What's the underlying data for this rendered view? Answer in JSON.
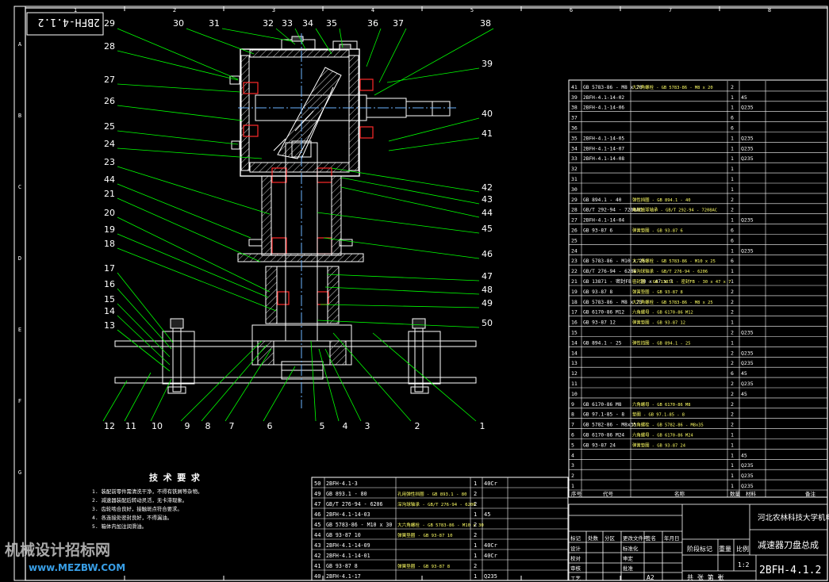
{
  "drawing": {
    "code": "2BFH-4.1.2",
    "code_rotated": "2BFH-4.1.2",
    "title": "减速器刀盘总成",
    "institution": "河北农林科技大学机电学院",
    "scale": "1:2",
    "sheet_size": "A2",
    "grid_cols": [
      "1",
      "2",
      "3",
      "4",
      "5",
      "6",
      "7",
      "8"
    ],
    "grid_rows": [
      "A",
      "B",
      "C",
      "D",
      "E",
      "F",
      "G"
    ]
  },
  "balloons_top": [
    "29",
    "30",
    "31",
    "32",
    "33",
    "34",
    "35",
    "36",
    "37",
    "38"
  ],
  "balloons_left": [
    "28",
    "27",
    "26",
    "25",
    "24",
    "23",
    "44",
    "21",
    "20",
    "19",
    "18",
    "17",
    "16",
    "15",
    "14",
    "13"
  ],
  "balloons_right": [
    "39",
    "40",
    "41",
    "42",
    "43",
    "44",
    "45",
    "46",
    "47",
    "48",
    "49",
    "50"
  ],
  "balloons_bottom": [
    "12",
    "11",
    "10",
    "9",
    "8",
    "7",
    "6",
    "5",
    "4",
    "3",
    "2",
    "1"
  ],
  "tech_req": {
    "title": "技 术 要 求",
    "items": [
      "1. 装配前零件需清洗干净，不得有铁屑等杂物。",
      "2. 减速器装配后转动灵活，无卡滞现象。",
      "3. 齿轮啮合良好，接触斑点符合要求。",
      "4. 各连接处密封良好，不得漏油。",
      "5. 箱体内加注润滑油。"
    ]
  },
  "bom_right": [
    [
      "41",
      "GB 5783-86 - M8 x 20",
      "大六角螺栓 - GB 5783-86 - M8 x 20",
      "2",
      "",
      ""
    ],
    [
      "39",
      "2BFH-4.1-14-02",
      "",
      "1",
      "45",
      ""
    ],
    [
      "38",
      "2BFH-4.1-14-06",
      "",
      "1",
      "Q235",
      ""
    ],
    [
      "37",
      "",
      "",
      "6",
      "",
      ""
    ],
    [
      "36",
      "",
      "",
      "6",
      "",
      ""
    ],
    [
      "35",
      "2BFH-4.1-14-05",
      "",
      "1",
      "Q235",
      ""
    ],
    [
      "34",
      "2BFH-4.1-14-07",
      "",
      "1",
      "Q235",
      ""
    ],
    [
      "33",
      "2BFH-4.1-14-08",
      "",
      "1",
      "Q235",
      ""
    ],
    [
      "32",
      "",
      "",
      "1",
      "",
      ""
    ],
    [
      "31",
      "",
      "",
      "1",
      "",
      ""
    ],
    [
      "30",
      "",
      "",
      "1",
      "",
      ""
    ],
    [
      "29",
      "GB 894.1 - 40",
      "弹性挡圈 - GB 894.1 - 40",
      "2",
      "",
      ""
    ],
    [
      "28",
      "GB/T 292-94 - 7208AC",
      "角接触球轴承 - GB/T 292-94 - 7208AC",
      "2",
      "",
      ""
    ],
    [
      "27",
      "2BFH-4.1-14-04",
      "",
      "1",
      "Q235",
      ""
    ],
    [
      "26",
      "GB 93-87 6",
      "弹簧垫圈 - GB 93-87 6",
      "6",
      "",
      ""
    ],
    [
      "25",
      "",
      "",
      "6",
      "",
      ""
    ],
    [
      "24",
      "",
      "",
      "1",
      "Q235",
      ""
    ],
    [
      "23",
      "GB 5783-86 - M10 x 25",
      "大六角螺栓 - GB 5783-86 - M10 x 25",
      "6",
      "",
      ""
    ],
    [
      "22",
      "GB/T 276-94 - 6206",
      "深沟球轴承 - GB/T 276-94 - 6206",
      "1",
      "",
      ""
    ],
    [
      "21",
      "GB 13871 - 密封FB - 30 x 47 x 7",
      "密封圈 - GB 13871 - 密封FB - 30 x 47 x 7",
      "1",
      "",
      ""
    ],
    [
      "19",
      "GB 93-87 8",
      "弹簧垫圈 - GB 93-87 8",
      "2",
      "",
      ""
    ],
    [
      "18",
      "GB 5783-86 - M8 x 25",
      "大六角螺栓 - GB 5783-86 - M8 x 25",
      "2",
      "",
      ""
    ],
    [
      "17",
      "GB 6170-86 M12",
      "六角螺母 - GB 6170-86 M12",
      "2",
      "",
      ""
    ],
    [
      "16",
      "GB 93-87 12",
      "弹簧垫圈 - GB 93-87 12",
      "1",
      "",
      ""
    ],
    [
      "15",
      "",
      "",
      "2",
      "Q235",
      ""
    ],
    [
      "14",
      "GB 894.1 - 25",
      "弹性挡圈 - GB 894.1 - 25",
      "1",
      "",
      ""
    ],
    [
      "14",
      "",
      "",
      "2",
      "Q235",
      ""
    ],
    [
      "13",
      "",
      "",
      "2",
      "Q235",
      ""
    ],
    [
      "12",
      "",
      "",
      "6",
      "45",
      ""
    ],
    [
      "11",
      "",
      "",
      "2",
      "Q235",
      ""
    ],
    [
      "10",
      "",
      "",
      "2",
      "45",
      ""
    ],
    [
      "9",
      "GB 6170-86 M8",
      "六角螺母 - GB 6170-86 M8",
      "2",
      "",
      ""
    ],
    [
      "8",
      "GB 97.1-85 - 8",
      "垫圈 - GB 97.1-85 - 8",
      "2",
      "",
      ""
    ],
    [
      "7",
      "GB 5782-86 - M8x35",
      "六角螺栓 - GB 5782-86 - M8x35",
      "2",
      "",
      ""
    ],
    [
      "6",
      "GB 6170-86 M24",
      "六角螺母 - GB 6170-86 M24",
      "1",
      "",
      ""
    ],
    [
      "5",
      "GB 93-87 24",
      "弹簧垫圈 - GB 93-87 24",
      "1",
      "",
      ""
    ],
    [
      "4",
      "",
      "",
      "1",
      "45",
      ""
    ],
    [
      "3",
      "",
      "",
      "1",
      "Q235",
      ""
    ],
    [
      "2",
      "",
      "",
      "1",
      "Q235",
      ""
    ],
    [
      "1",
      "",
      "",
      "1",
      "Q235",
      ""
    ]
  ],
  "bom_right_header": [
    "序号",
    "代号",
    "名称",
    "数量",
    "材料",
    "备注"
  ],
  "bom_bottom": [
    [
      "50",
      "2BFH-4.1-3",
      "",
      "1",
      "40Cr"
    ],
    [
      "49",
      "GB 893.1 - 80",
      "孔用弹性挡圈 - GB 893.1 - 80",
      "2",
      ""
    ],
    [
      "47",
      "GB/T 276-94 - 6206",
      "深沟球轴承 - GB/T 276-94 - 6206",
      "2",
      ""
    ],
    [
      "46",
      "2BFH-4.1-14-03",
      "",
      "1",
      "45"
    ],
    [
      "45",
      "GB 5783-86 - M10 x 30",
      "大六角螺栓 - GB 5783-86 - M10 x 30",
      "2",
      ""
    ],
    [
      "44",
      "GB 93-87 10",
      "弹簧垫圈 - GB 93-87 10",
      "2",
      ""
    ],
    [
      "43",
      "2BFH-4.1-14-09",
      "",
      "1",
      "40Cr"
    ],
    [
      "42",
      "2BFH-4.1-14-01",
      "",
      "1",
      "40Cr"
    ],
    [
      "41",
      "GB 93-87 8",
      "弹簧垫圈 - GB 93-87 8",
      "2",
      ""
    ],
    [
      "40",
      "2BFH-4.1-17",
      "",
      "1",
      "Q235"
    ]
  ],
  "title_block": {
    "labels_row1": [
      "标记",
      "处数",
      "分区",
      "更改文件号",
      "签名",
      "年月日"
    ],
    "labels_left": [
      "设计",
      "校对",
      "审核",
      "工艺"
    ],
    "labels_mid": [
      "标准化",
      "审定",
      "批准"
    ],
    "stage": "阶段标记",
    "weight": "重量",
    "ratio": "比例",
    "sheets": "共  张  第  张"
  },
  "watermark": {
    "line1": "机械设计招标网",
    "line2": "www.MEZBW.COM"
  },
  "colors": {
    "bg": "#000000",
    "line": "#ffffff",
    "leader": "#00ff00",
    "section": "#ff2a2a",
    "hatch": "#ffffff",
    "center": "#6bb3ff",
    "frame": "#ffffff"
  }
}
